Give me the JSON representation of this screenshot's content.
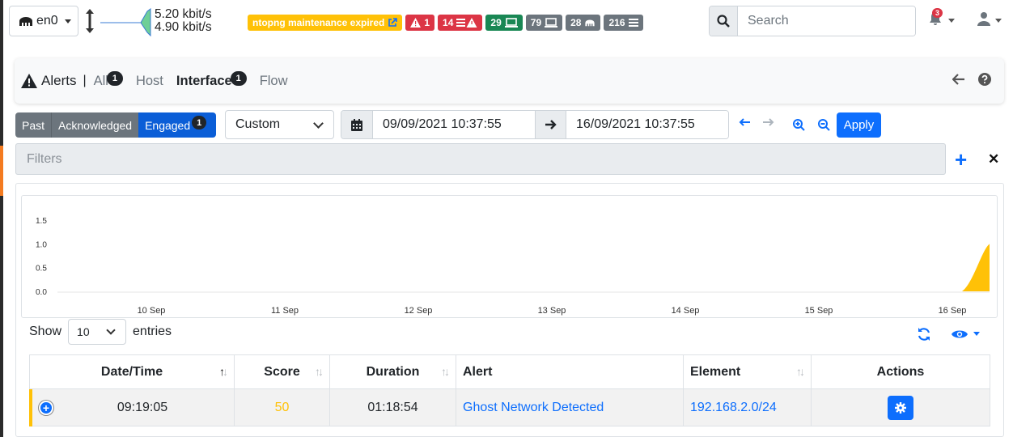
{
  "topbar": {
    "interface": "en0",
    "speed_up": "5.20 kbit/s",
    "speed_down": "4.90 kbit/s",
    "badges": [
      {
        "text": "ntopng maintenance expired",
        "icon": "external-link-icon",
        "color": "#ffc107"
      },
      {
        "text": "1",
        "icon": "warning-icon",
        "color": "#dc3545"
      },
      {
        "text": "14",
        "icon": "list-warning-icon",
        "color": "#dc3545"
      },
      {
        "text": "29",
        "icon": "laptop-icon",
        "color": "#198754"
      },
      {
        "text": "79",
        "icon": "laptop-icon",
        "color": "#6c757d"
      },
      {
        "text": "28",
        "icon": "network-icon",
        "color": "#6c757d"
      },
      {
        "text": "216",
        "icon": "list-icon",
        "color": "#6c757d"
      }
    ],
    "search_placeholder": "Search",
    "notifications_count": "3"
  },
  "header": {
    "title": "Alerts",
    "separator": "|",
    "tabs": [
      {
        "label": "All",
        "count": "1"
      },
      {
        "label": "Host",
        "count": ""
      },
      {
        "label": "Interface",
        "count": "1"
      },
      {
        "label": "Flow",
        "count": ""
      }
    ]
  },
  "status_buttons": [
    {
      "label": "Past"
    },
    {
      "label": "Acknowledged"
    },
    {
      "label": "Engaged",
      "count": "1"
    }
  ],
  "range": {
    "preset": "Custom",
    "from": "09/09/2021 10:37:55",
    "to": "16/09/2021 10:37:55",
    "apply": "Apply"
  },
  "filters": {
    "placeholder": "Filters"
  },
  "chart_data": {
    "type": "area",
    "x": [
      "10 Sep",
      "11 Sep",
      "12 Sep",
      "13 Sep",
      "14 Sep",
      "15 Sep",
      "16 Sep"
    ],
    "yticks": [
      "1.5",
      "1.0",
      "0.5",
      "0.0"
    ],
    "ylim": [
      0,
      1.5
    ],
    "series": [
      {
        "values": [
          0,
          0,
          0,
          0,
          0,
          0,
          1
        ]
      }
    ],
    "color": "#ffc107"
  },
  "table": {
    "show_label": "Show",
    "page_size": "10",
    "entries_label": "entries",
    "headers": [
      "Date/Time",
      "Score",
      "Duration",
      "Alert",
      "Element",
      "Actions"
    ],
    "rows": [
      {
        "datetime": "09:19:05",
        "score": "50",
        "duration": "01:18:54",
        "alert": "Ghost Network Detected",
        "element": "192.168.2.0/24"
      }
    ]
  }
}
